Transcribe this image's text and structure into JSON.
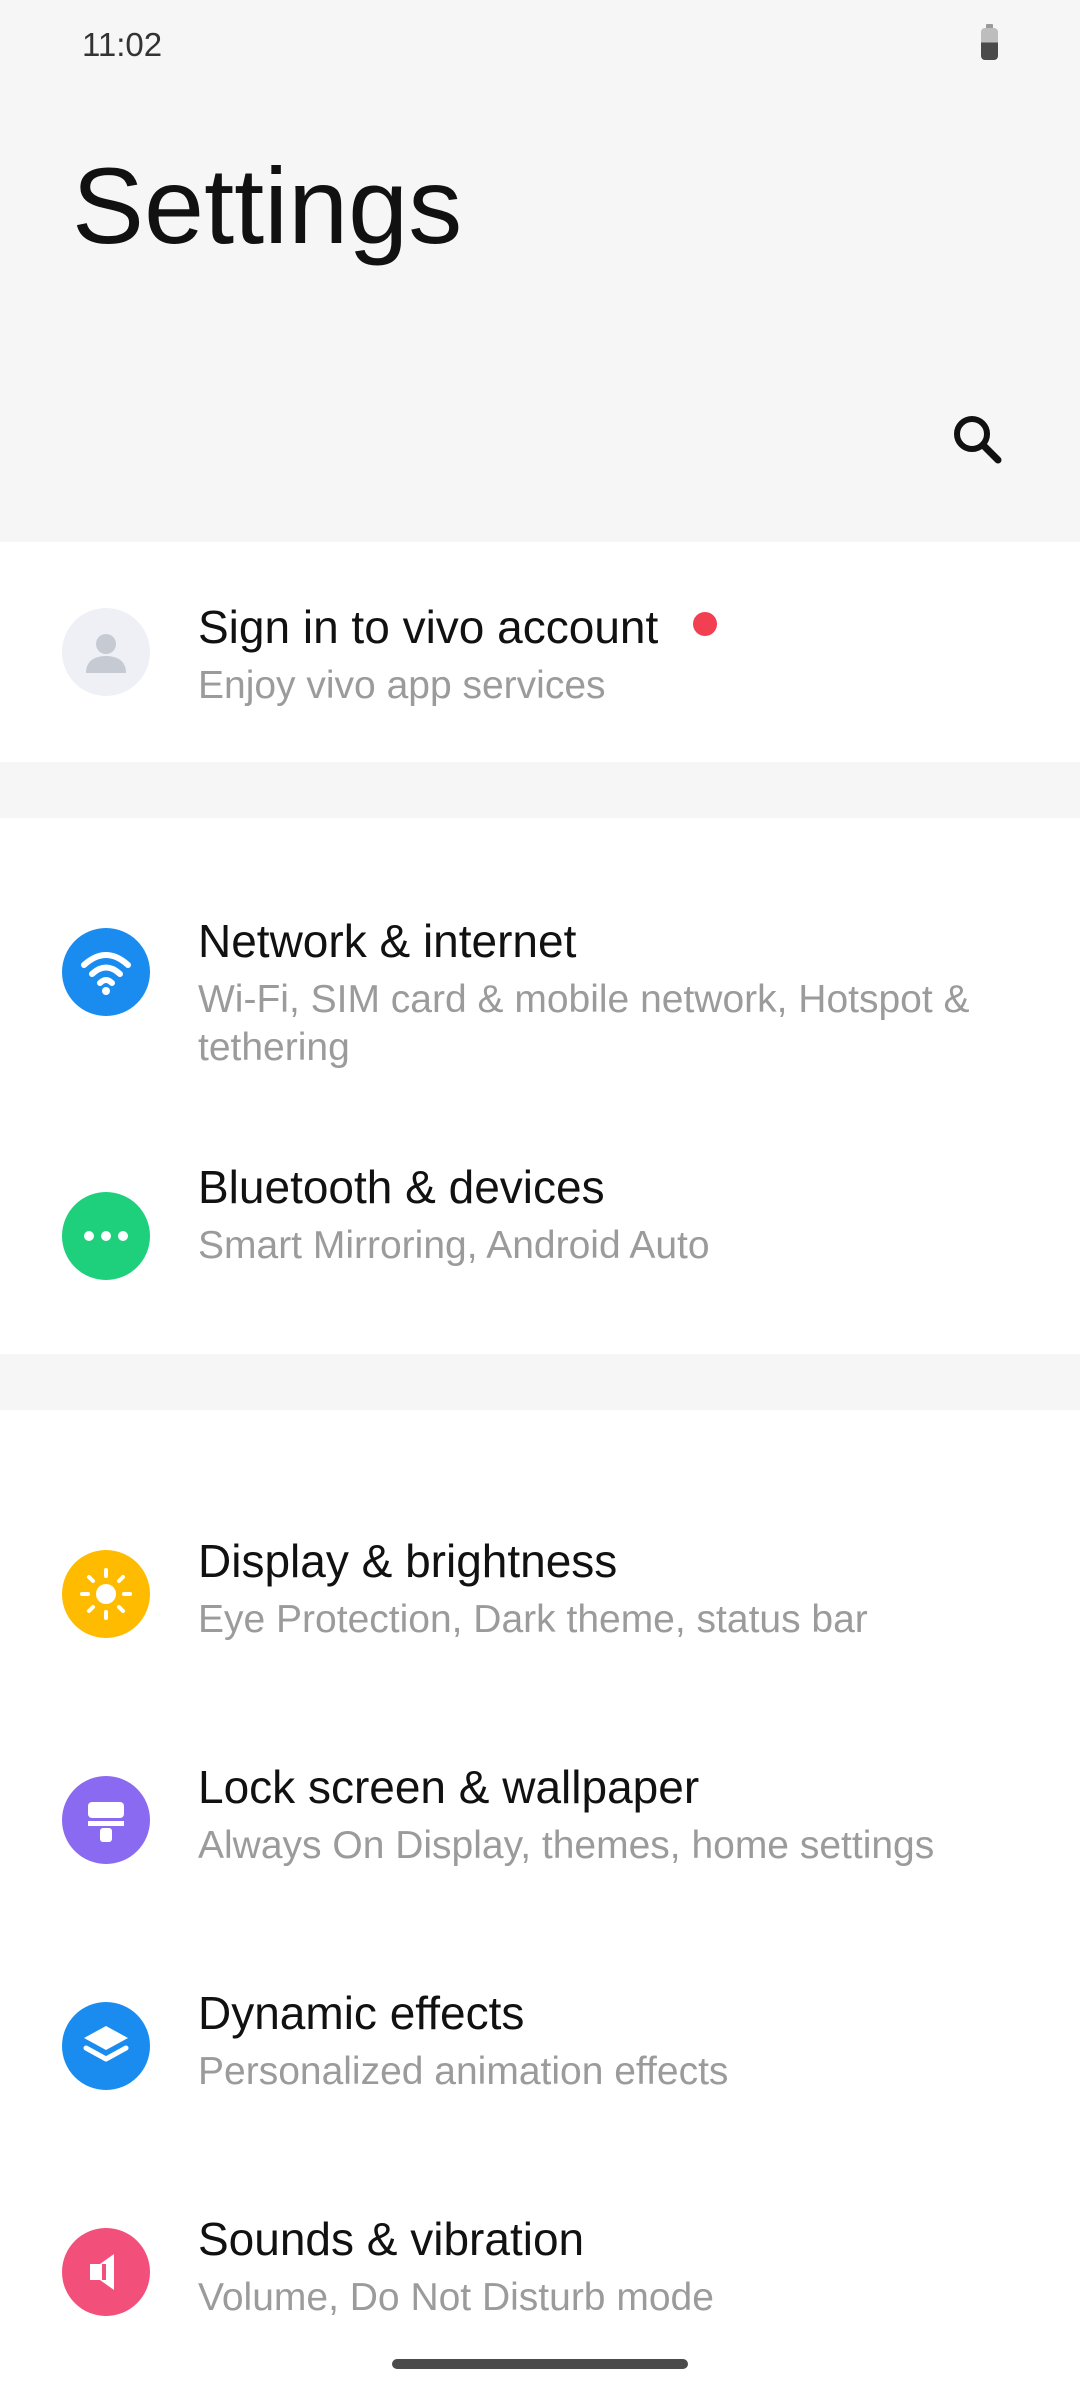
{
  "status_bar": {
    "time": "11:02"
  },
  "header": {
    "title": "Settings",
    "search_icon": "search-icon"
  },
  "account": {
    "title": "Sign in to vivo account",
    "subtitle": "Enjoy vivo app services",
    "icon": "avatar-icon",
    "badge_color": "#f23f52"
  },
  "items": [
    {
      "title": "Network & internet",
      "subtitle": "Wi-Fi, SIM card & mobile network, Hotspot & tethering",
      "icon": "wifi-icon",
      "color": "#1a8cf0"
    },
    {
      "title": "Bluetooth & devices",
      "subtitle": "Smart Mirroring, Android Auto",
      "icon": "more-dots-icon",
      "color": "#1ed07c"
    },
    {
      "title": "Display & brightness",
      "subtitle": "Eye Protection, Dark theme, status bar",
      "icon": "sun-icon",
      "color": "#ffbb00"
    },
    {
      "title": "Lock screen & wallpaper",
      "subtitle": "Always On Display, themes, home settings",
      "icon": "brush-icon",
      "color": "#8a6af0"
    },
    {
      "title": "Dynamic effects",
      "subtitle": "Personalized animation effects",
      "icon": "layers-icon",
      "color": "#1a8cf0"
    },
    {
      "title": "Sounds & vibration",
      "subtitle": "Volume, Do Not Disturb mode",
      "icon": "speaker-icon",
      "color": "#f24f7a"
    }
  ]
}
